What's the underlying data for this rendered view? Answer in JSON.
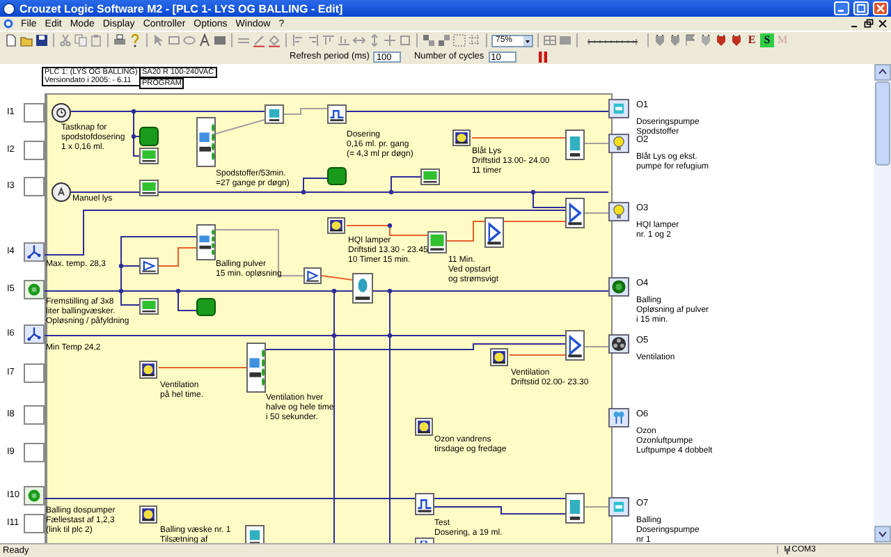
{
  "window": {
    "title": "Crouzet Logic Software M2 - [PLC 1-  LYS OG BALLING - Edit]"
  },
  "menu": [
    "File",
    "Edit",
    "Mode",
    "Display",
    "Controller",
    "Options",
    "Window",
    "?"
  ],
  "toolbar": {
    "zoom": "75%",
    "modes": [
      {
        "label": "E",
        "selected": false,
        "disabled": false
      },
      {
        "label": "S",
        "selected": true,
        "disabled": false
      },
      {
        "label": "M",
        "selected": false,
        "disabled": true
      }
    ]
  },
  "monitor": {
    "refresh_label": "Refresh period (ms)",
    "refresh_value": "100",
    "cycles_label": "Number of cycles",
    "cycles_value": "10"
  },
  "header": {
    "plc": "PLC 1: (LYS OG BALLING)\nVersiondato i 2005: - 6.11",
    "supply": "SA20 R 100-240VAC",
    "mode": "PROGRAM"
  },
  "inputs": [
    {
      "label": "I1",
      "kind": "empty"
    },
    {
      "label": "I2",
      "kind": "empty"
    },
    {
      "label": "I3",
      "kind": "empty"
    },
    {
      "label": "I4",
      "kind": "sensor"
    },
    {
      "label": "I5",
      "kind": "switch"
    },
    {
      "label": "I6",
      "kind": "sensor"
    },
    {
      "label": "I7",
      "kind": "empty"
    },
    {
      "label": "I8",
      "kind": "empty"
    },
    {
      "label": "I9",
      "kind": "empty"
    },
    {
      "label": "I10",
      "kind": "switch"
    },
    {
      "label": "I11",
      "kind": "empty"
    }
  ],
  "outputs": [
    {
      "label": "O1",
      "kind": "pump",
      "text": "Doseringspumpe\nSpodstoffer"
    },
    {
      "label": "O2",
      "kind": "lamp",
      "text": "Blåt Lys og ekst.\npumpe for refugium"
    },
    {
      "label": "O3",
      "kind": "lamp",
      "text": "HQI lamper\nnr. 1 og 2"
    },
    {
      "label": "O4",
      "kind": "motor",
      "text": "Balling\nOpløsning af pulver\ni 15 min."
    },
    {
      "label": "O5",
      "kind": "fan",
      "text": "Ventilation"
    },
    {
      "label": "O6",
      "kind": "ozone",
      "text": "Ozon\nOzonluftpumpe\nLuftpumpe 4 dobbelt"
    },
    {
      "label": "O7",
      "kind": "pump",
      "text": "Balling\nDoseringspumpe\nnr 1"
    }
  ],
  "comments": [
    "Tastknap for\nspodstofdosering\n1 x 0,16 ml.",
    "Spodstoffer/53min.\n=27 gange pr døgn)",
    "Dosering\n0,16 ml. pr. gang\n(= 4,3 ml pr døgn)",
    "Blåt Lys\nDriftstid 13.00- 24.00\n11 timer",
    "Manuel lys",
    "Max. temp. 28,3",
    "Balling pulver\n15 min. opløsning",
    "HQI lamper\nDriftstid 13.30 - 23.45\n10 Timer 15 min.",
    "11 Min.\nVed opstart\nog strømsvigt",
    "Fremstilling af 3x8\nliter ballingvæsker.\nOpløsning / påfyldning",
    "Min Temp 24,2",
    "Ventilation\npå hel time.",
    "Ventilation hver\nhalve og hele time\ni 50 sekunder.",
    "Ventilation\nDriftstid 02.00- 23.30",
    "Ozon vandrens\ntirsdage og fredage",
    "Balling dospumper\nFællestast af 1,2,3\n(link til plc 2)",
    "Balling væske nr. 1\nTilsætning af",
    "Test\nDosering, a 19 ml."
  ],
  "status_bar": {
    "text": "Ready",
    "port": "COM3"
  }
}
